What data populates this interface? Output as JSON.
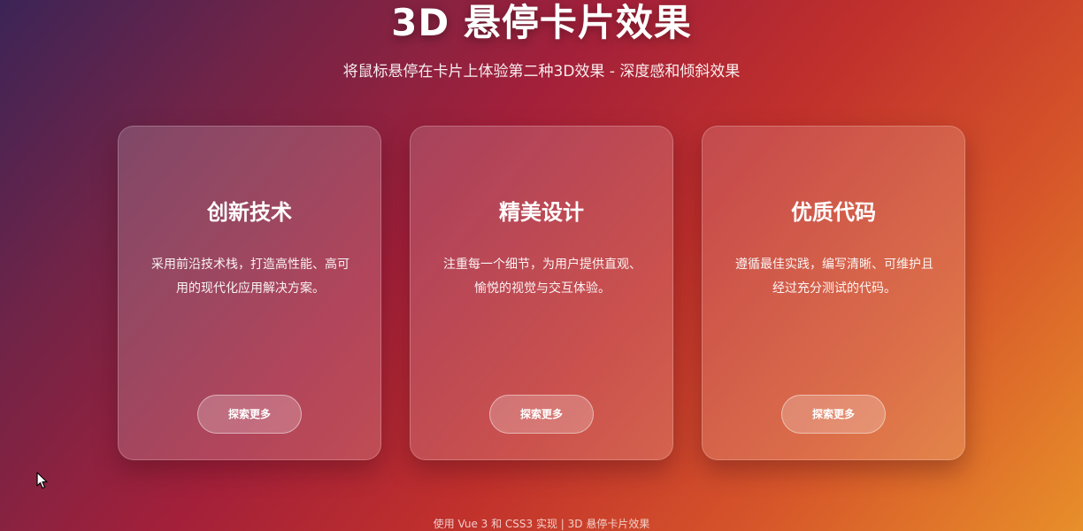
{
  "header": {
    "title": "3D 悬停卡片效果",
    "subtitle": "将鼠标悬停在卡片上体验第二种3D效果 - 深度感和倾斜效果"
  },
  "cards": [
    {
      "title": "创新技术",
      "description": "采用前沿技术栈，打造高性能、高可用的现代化应用解决方案。",
      "button_label": "探索更多"
    },
    {
      "title": "精美设计",
      "description": "注重每一个细节，为用户提供直观、愉悦的视觉与交互体验。",
      "button_label": "探索更多"
    },
    {
      "title": "优质代码",
      "description": "遵循最佳实践，编写清晰、可维护且经过充分测试的代码。",
      "button_label": "探索更多"
    }
  ],
  "footer": {
    "text": "使用 Vue 3 和 CSS3 实现 | 3D 悬停卡片效果"
  },
  "icons": {
    "cursor": "mouse-pointer-icon"
  },
  "colors": {
    "gradient_start": "#3c2457",
    "gradient_mid": "#c0302c",
    "gradient_end": "#e88f2a"
  }
}
